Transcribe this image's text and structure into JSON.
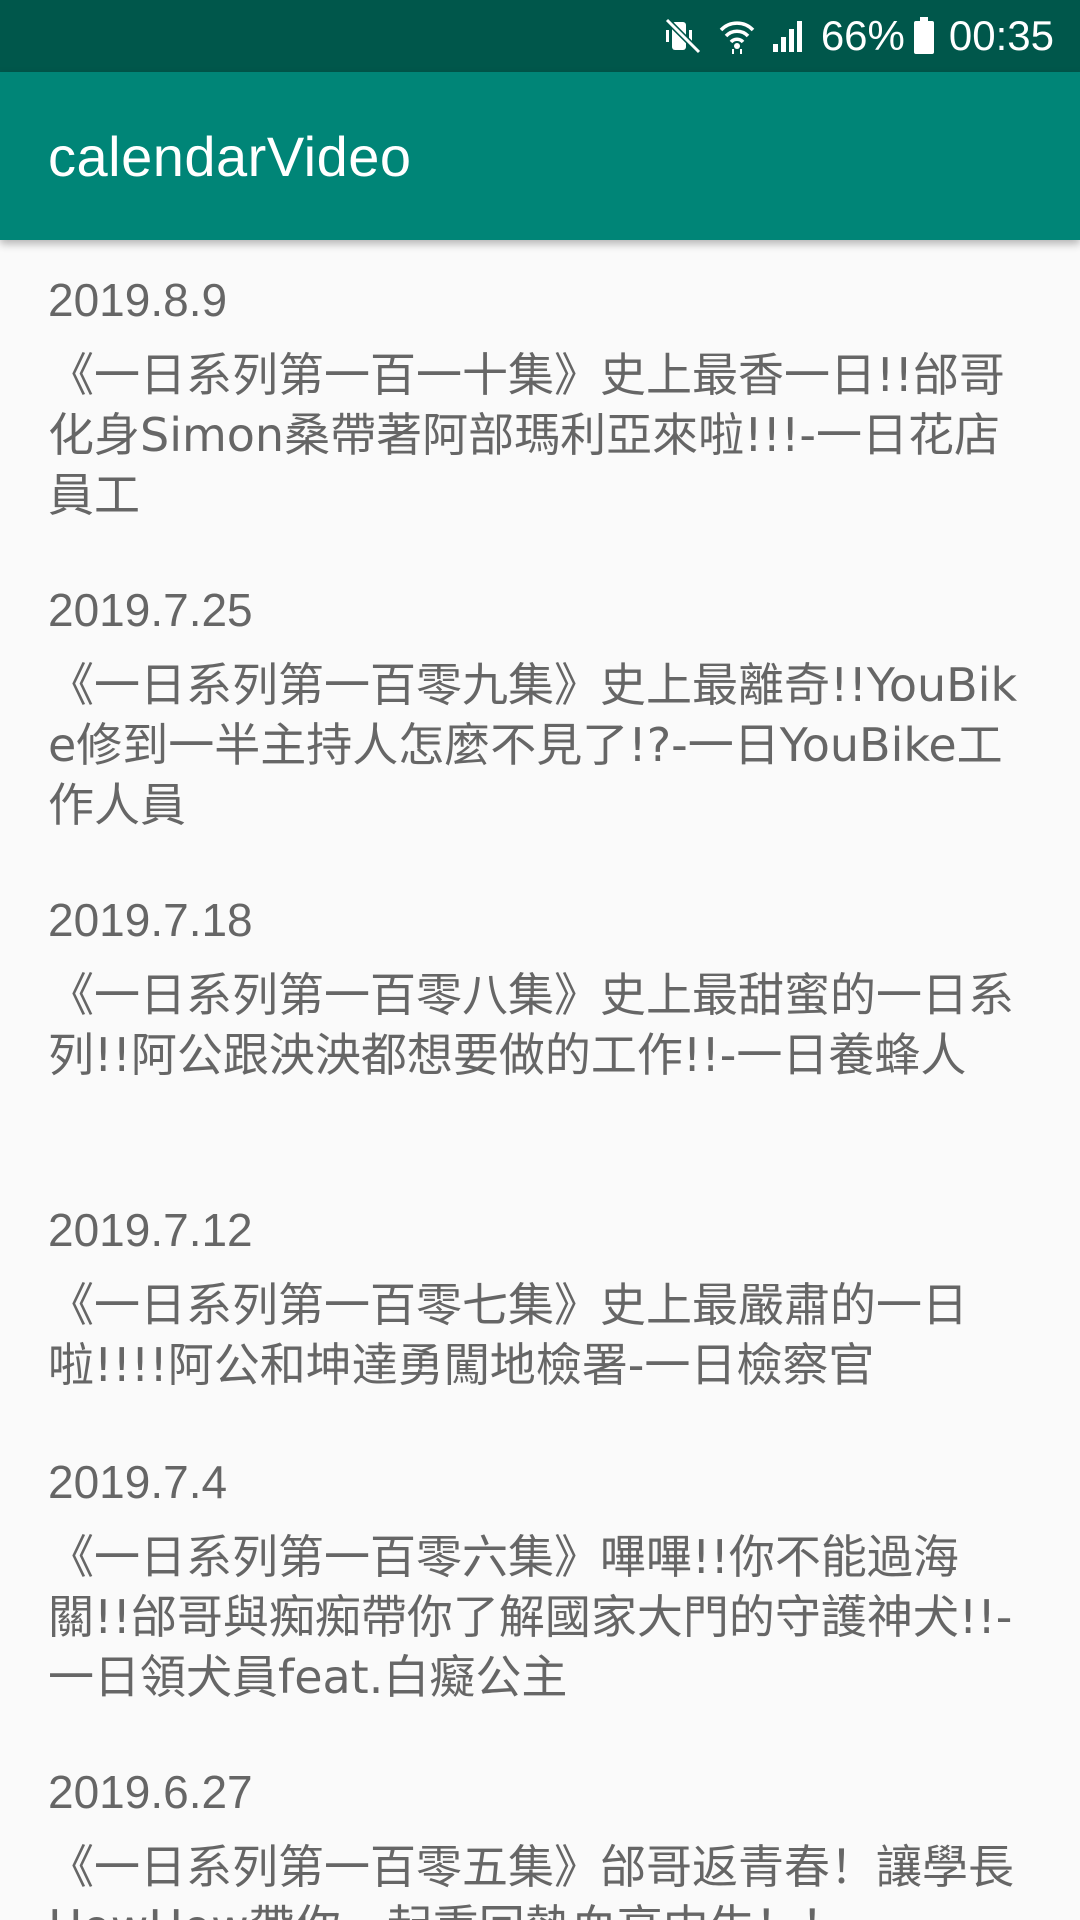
{
  "status_bar": {
    "battery_percent": "66%",
    "time": "00:35",
    "icons": [
      "mute-vibrate-icon",
      "wifi-icon",
      "cell-signal-icon",
      "battery-icon"
    ],
    "background": "#00574b"
  },
  "app_bar": {
    "title": "calendarVideo",
    "background": "#008577"
  },
  "videos": [
    {
      "date": "2019.8.9",
      "title": "《一日系列第一百一十集》史上最香一日!!邰哥化身Simon桑帶著阿部瑪利亞來啦!!!-一日花店員工"
    },
    {
      "date": "2019.7.25",
      "title": "《一日系列第一百零九集》史上最離奇!!YouBike修到一半主持人怎麼不見了!?-一日YouBike工作人員"
    },
    {
      "date": "2019.7.18",
      "title": "《一日系列第一百零八集》史上最甜蜜的一日系列!!阿公跟泱泱都想要做的工作!!-一日養蜂人"
    },
    {
      "date": "2019.7.12",
      "title": "《一日系列第一百零七集》史上最嚴肅的一日啦!!!!阿公和坤達勇闖地檢署-一日檢察官"
    },
    {
      "date": "2019.7.4",
      "title": "《一日系列第一百零六集》嗶嗶!!你不能過海關!!邰哥與痴痴帶你了解國家大門的守護神犬!!-一日領犬員feat.白癡公主"
    },
    {
      "date": "2019.6.27",
      "title": "《一日系列第一百零五集》邰哥返青春！讓學長HowHow帶你一起重回熱血高中生！！"
    }
  ]
}
